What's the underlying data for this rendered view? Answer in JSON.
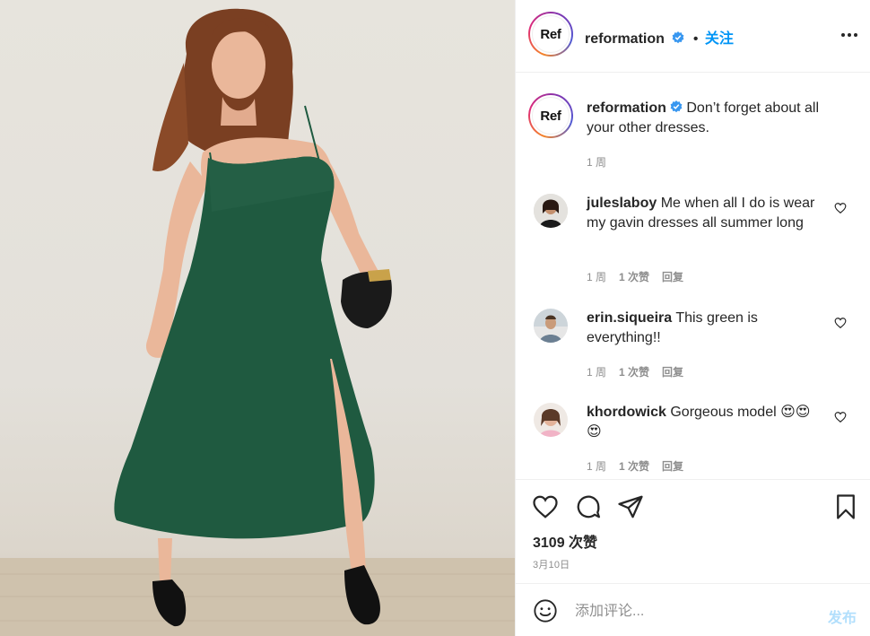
{
  "photo": {
    "subject": "model-in-green-dress"
  },
  "header": {
    "avatar_text": "Ref",
    "username": "reformation",
    "separator": "•",
    "follow_label": "关注"
  },
  "caption": {
    "avatar_text": "Ref",
    "username": "reformation",
    "text": "Don’t forget about all your other dresses.",
    "time": "1 周"
  },
  "comments": [
    {
      "username": "juleslaboy",
      "text": "Me when all I do is wear my gavin dresses all summer long",
      "time": "1 周",
      "likes": "1 次赞",
      "reply": "回复"
    },
    {
      "username": "erin.siqueira",
      "text": "This green is everything!!",
      "time": "1 周",
      "likes": "1 次赞",
      "reply": "回复"
    },
    {
      "username": "khordowick",
      "text": "Gorgeous model 😍😍😍",
      "time": "1 周",
      "likes": "1 次赞",
      "reply": "回复"
    }
  ],
  "actions": {
    "likes_count": "3109 次赞",
    "date": "3月10日"
  },
  "add_comment": {
    "placeholder": "添加评论...",
    "post_label": "发布"
  },
  "colors": {
    "accent": "#0095f6",
    "dress": "#1f5a40",
    "verified": "#3897f0"
  }
}
